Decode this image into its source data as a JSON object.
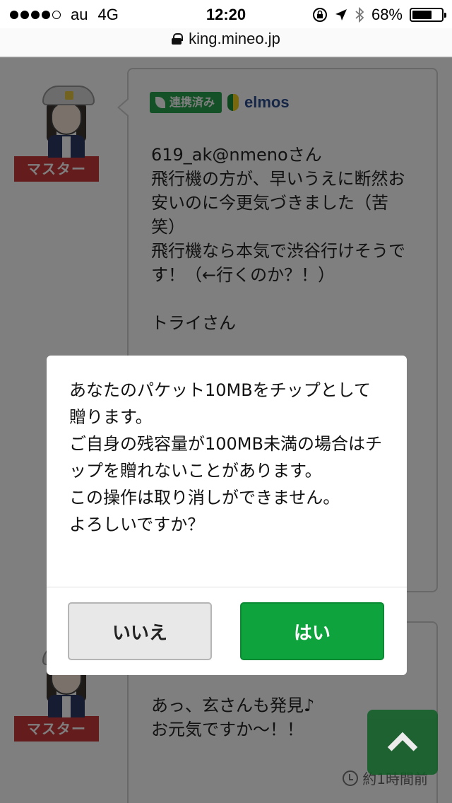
{
  "status_bar": {
    "carrier": "au",
    "network": "4G",
    "time": "12:20",
    "battery": "68%",
    "battery_level": 0.68
  },
  "url_bar": {
    "url": "king.mineo.jp"
  },
  "posts": [
    {
      "badge": "マスター",
      "linked_label": "連携済み",
      "username": "elmos",
      "message": "619_ak@nmenoさん\n飛行機の方が、早いうえに断然お安いのに今更気づきました（苦笑）\n飛行機なら本気で渋谷行けそうです！（←行くのか？！）\n\nトライさん"
    },
    {
      "badge": "マスター",
      "message": "あっ、玄さんも発見♪\nお元気ですか～！！",
      "timestamp": "約1時間前"
    }
  ],
  "dialog": {
    "message": "あなたのパケット10MBをチップとして贈ります。\nご自身の残容量が100MB未満の場合はチップを贈れないことがあります。\nこの操作は取り消しができません。\nよろしいですか？",
    "cancel_label": "いいえ",
    "confirm_label": "はい"
  },
  "colors": {
    "master_badge": "#c8383a",
    "linked_badge": "#2ba24c",
    "confirm_button": "#0ea33d",
    "username": "#2a4c8f"
  },
  "icons": {
    "lock": "lock-icon",
    "scroll_top": "chevron-up-icon",
    "clock": "clock-icon"
  }
}
